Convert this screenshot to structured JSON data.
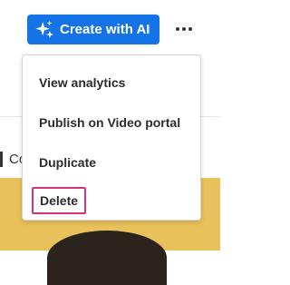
{
  "toolbar": {
    "create_ai_label": "Create with AI",
    "create_ai_icon": "sparkle-icon",
    "more_icon": "more-horizontal-icon"
  },
  "background": {
    "tab_label": "Co"
  },
  "menu": {
    "items": [
      {
        "label": "View analytics"
      },
      {
        "label": "Publish on Video portal"
      },
      {
        "label": "Duplicate"
      },
      {
        "label": "Delete",
        "highlighted": true
      }
    ]
  },
  "colors": {
    "primary": "#1473e6",
    "highlight_border": "#d6317b",
    "hero_background": "#e8c15a"
  }
}
